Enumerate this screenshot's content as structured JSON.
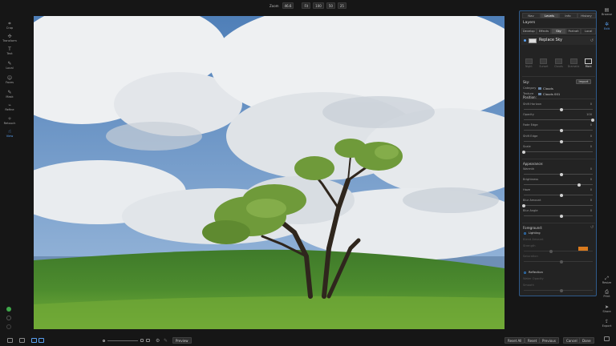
{
  "topbar": {
    "zoom_label": "Zoom",
    "zoom_value": "46.6",
    "zoom_buttons": [
      "Fit",
      "100",
      "50",
      "25"
    ]
  },
  "left_tools": [
    {
      "label": "Crop",
      "icon": "crop-icon"
    },
    {
      "label": "Transform",
      "icon": "transform-icon"
    },
    {
      "label": "Text",
      "icon": "text-icon"
    },
    {
      "label": "Local",
      "icon": "brush-icon"
    },
    {
      "label": "Faces",
      "icon": "face-icon"
    },
    {
      "label": "Mask",
      "icon": "mask-icon"
    },
    {
      "label": "Refine",
      "icon": "refine-icon"
    },
    {
      "label": "Retouch",
      "icon": "retouch-icon"
    },
    {
      "label": "View",
      "icon": "view-icon",
      "active": true
    }
  ],
  "panel": {
    "tabs": [
      "Nav",
      "Levels",
      "Info",
      "History"
    ],
    "active_tab": "Levels",
    "layers_title": "Layers",
    "subtabs": [
      "Develop",
      "Effects",
      "Sky",
      "Portrait",
      "Local"
    ],
    "active_subtab": "Sky",
    "filter_name": "Replace Sky",
    "presets": [
      {
        "label": "Night"
      },
      {
        "label": "Sunset"
      },
      {
        "label": "Clouds"
      },
      {
        "label": "Dramatic"
      },
      {
        "label": "More"
      }
    ],
    "sky": {
      "label": "Sky:",
      "import_label": "Import",
      "category_label": "Category",
      "category_value": "Clouds",
      "texture_label": "Texture",
      "texture_value": "Clouds 001"
    },
    "position": {
      "label": "Position:",
      "shift_horizon": {
        "label": "Shift Horizon",
        "value": "0",
        "level": 0.55
      },
      "opacity": {
        "label": "Opacity",
        "value": "100",
        "level": 1.0
      },
      "fade_edge": {
        "label": "Fade Edge",
        "value": "0",
        "level": 0.55
      },
      "shift_edge": {
        "label": "Shift Edge",
        "value": "0",
        "level": 0.55
      },
      "scale": {
        "label": "Scale",
        "value": "0",
        "level": 0.0
      }
    },
    "appearance": {
      "label": "Appearance:",
      "warmth": {
        "label": "Warmth",
        "value": "0",
        "level": 0.55
      },
      "brightness": {
        "label": "Brightness",
        "value": "0",
        "level": 0.8
      },
      "haze": {
        "label": "Haze",
        "value": "0",
        "level": 0.55
      },
      "blur_amount": {
        "label": "Blur Amount",
        "value": "0",
        "level": 0.0
      },
      "blur_angle": {
        "label": "Blur Angle",
        "value": "0",
        "level": 0.55
      }
    },
    "foreground": {
      "label": "Foreground:",
      "lighting_label": "Lighting",
      "lighting_sub": "Blend Amount",
      "lighting_color": "#d97a1e",
      "strength_label": "Strength",
      "saturation_label": "Saturation",
      "reflection_label": "Reflection",
      "water_label": "Water Opacity",
      "smooth_label": "Smooth"
    }
  },
  "right_strip": [
    {
      "label": "Browse",
      "icon": "browse-icon"
    },
    {
      "label": "Edit",
      "icon": "edit-icon",
      "active": true
    },
    {
      "label": "Resize",
      "icon": "resize-icon"
    },
    {
      "label": "Print",
      "icon": "print-icon"
    },
    {
      "label": "Share",
      "icon": "share-icon"
    },
    {
      "label": "Export",
      "icon": "export-icon"
    }
  ],
  "bottombar": {
    "preview_label": "Preview",
    "reset_all_label": "Reset All",
    "reset_label": "Reset",
    "previous_label": "Previous",
    "cancel_label": "Cancel",
    "done_label": "Done"
  },
  "colors": {
    "accent": "#5aa0f0",
    "panel_bg": "#232323",
    "app_bg": "#161616"
  }
}
